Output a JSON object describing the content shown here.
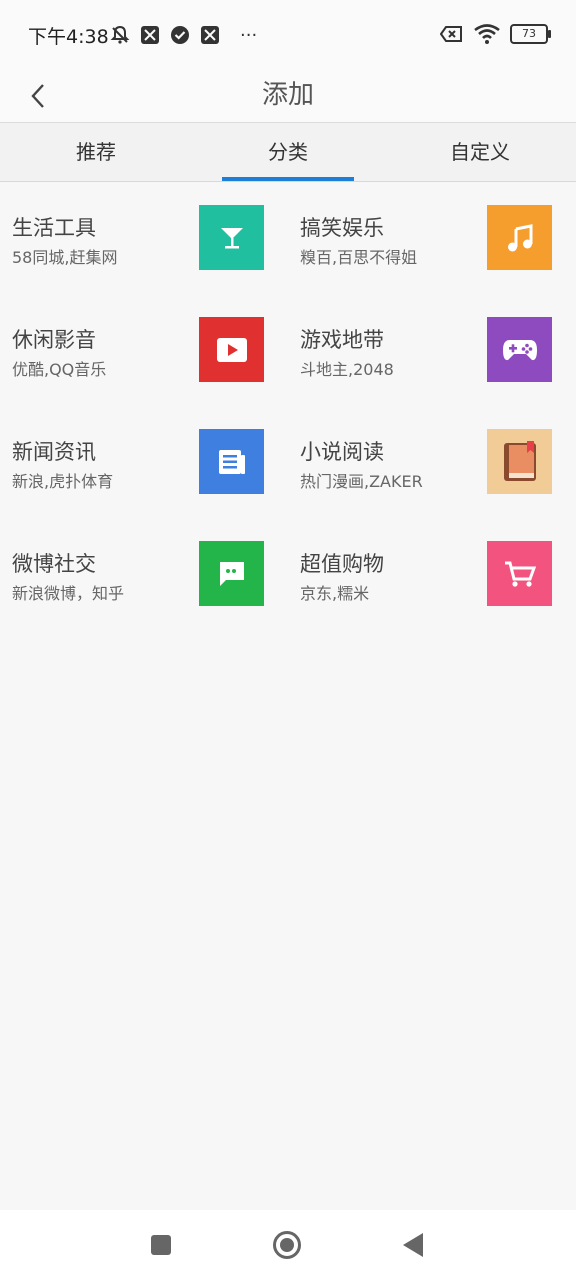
{
  "status_bar": {
    "time": "下午4:38",
    "more": "···",
    "battery": "73"
  },
  "app_bar": {
    "title": "添加"
  },
  "tabs": [
    {
      "label": "推荐"
    },
    {
      "label": "分类",
      "active": true
    },
    {
      "label": "自定义"
    }
  ],
  "categories": [
    {
      "title": "生活工具",
      "subtitle": "58同城,赶集网",
      "icon": "cocktail-icon",
      "color": "#1fbf9f"
    },
    {
      "title": "搞笑娱乐",
      "subtitle": "糗百,百思不得姐",
      "icon": "music-note-icon",
      "color": "#f59e2e"
    },
    {
      "title": "休闲影音",
      "subtitle": "优酷,QQ音乐",
      "icon": "play-icon",
      "color": "#e03030"
    },
    {
      "title": "游戏地带",
      "subtitle": "斗地主,2048",
      "icon": "gamepad-icon",
      "color": "#8e4bbf"
    },
    {
      "title": "新闻资讯",
      "subtitle": "新浪,虎扑体育",
      "icon": "news-icon",
      "color": "#3f7fe0"
    },
    {
      "title": "小说阅读",
      "subtitle": "热门漫画,ZAKER",
      "icon": "book-icon",
      "color": "#f1cc97"
    },
    {
      "title": "微博社交",
      "subtitle": "新浪微博，知乎",
      "icon": "chat-icon",
      "color": "#23b44a"
    },
    {
      "title": "超值购物",
      "subtitle": "京东,糯米",
      "icon": "cart-icon",
      "color": "#f2547f"
    }
  ]
}
